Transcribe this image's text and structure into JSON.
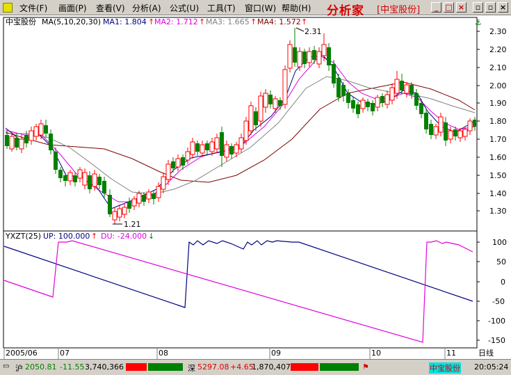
{
  "menu": {
    "items": [
      "文件(F)",
      "画面(P)",
      "查看(V)",
      "分析(A)",
      "公式(U)",
      "工具(T)",
      "窗口(W)",
      "帮助(H)"
    ],
    "brand": "分析家",
    "stock_title": "[中宝股份]",
    "window_buttons": [
      "_",
      "□",
      "×"
    ]
  },
  "price_panel": {
    "stock_name": "中宝股份",
    "indicator": "MA(5,10,20,30)",
    "ma": [
      {
        "label": "MA1: 1.804",
        "color": "#000080"
      },
      {
        "label": "MA2: 1.712",
        "color": "#e000e0"
      },
      {
        "label": "MA3: 1.665",
        "color": "#808080"
      },
      {
        "label": "MA4: 1.572",
        "color": "#800000"
      }
    ],
    "arrow_color": "#ff0000",
    "yticks": [
      "2.30",
      "2.20",
      "2.10",
      "2.00",
      "1.90",
      "1.80",
      "1.70",
      "1.60",
      "1.50",
      "1.40",
      "1.30"
    ],
    "high_label": "2.31",
    "low_label": "1.21"
  },
  "indicator_panel": {
    "name": "YXZT(25)",
    "up_label": "UP: 100.000",
    "du_label": "DU: -24.000",
    "up_color": "#000080",
    "du_color": "#e000e0",
    "yticks": [
      "100",
      "50",
      "0",
      "-50",
      "-100",
      "-150"
    ]
  },
  "xaxis": {
    "labels": [
      "2005/06",
      "07",
      "08",
      "09",
      "10",
      "11"
    ],
    "period": "日线"
  },
  "colors": {
    "up_candle": "#ff0000",
    "down_candle": "#008000"
  },
  "statusbar": {
    "sh_label": "沪",
    "sh_index": "2050.81",
    "sh_change": "-11.55",
    "sh_volume": "3,740,366",
    "sz_label": "深",
    "sz_index": "5297.08",
    "sz_change": "+4.65",
    "sz_volume": "1,870,407",
    "stock": "中宝股份",
    "time": "20:05:24"
  }
}
